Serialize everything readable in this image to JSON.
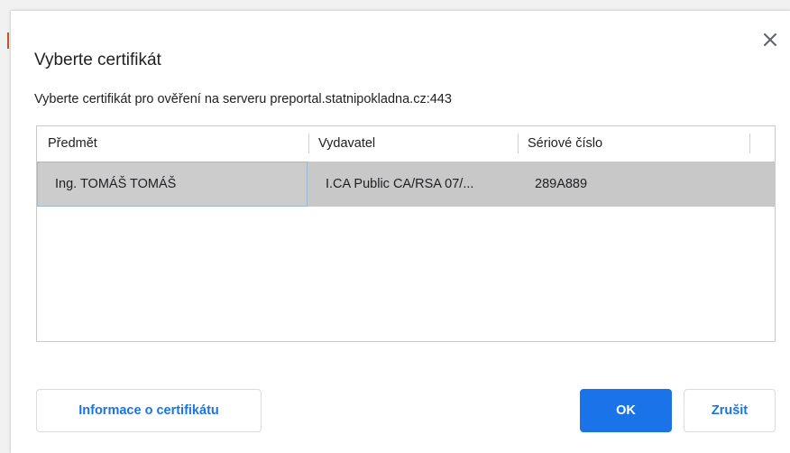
{
  "dialog": {
    "title": "Vyberte certifikát",
    "description": "Vyberte certifikát pro ověření na serveru preportal.statnipokladna.cz:443",
    "close_icon": "close-icon"
  },
  "table": {
    "columns": [
      "Předmět",
      "Vydavatel",
      "Sériové číslo"
    ],
    "rows": [
      {
        "subject": "Ing. TOMÁŠ TOMÁŠ",
        "issuer": "I.CA Public CA/RSA 07/...",
        "serial": "289A889",
        "selected": true
      }
    ]
  },
  "buttons": {
    "info_label": "Informace o certifikátu",
    "ok_label": "OK",
    "cancel_label": "Zrušit"
  },
  "colors": {
    "accent": "#1a73e8",
    "selected_row": "#c8c8c8"
  }
}
